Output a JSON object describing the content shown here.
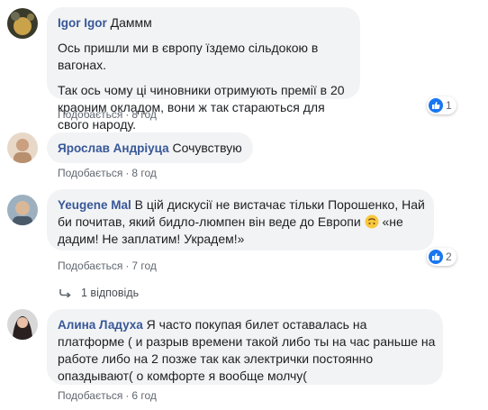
{
  "comments": [
    {
      "author": "Igor Igor",
      "text_inline": "Даммм",
      "paragraphs": [
        "Ось пришли ми в європу їздемо сільдокою в вагонах.",
        "Так ось чому ці чиновники отримують премії в 20 краоним окладом, вони ж так стараються для свого народу."
      ],
      "like": "Подобається",
      "time": "8 год",
      "reactions": "1"
    },
    {
      "author": "Ярослав Андріуца",
      "text_inline": "Сочувствую",
      "like": "Подобається",
      "time": "8 год"
    },
    {
      "author": "Yeugene Mal",
      "text_line1": "В цій дискусії не вистачає тільки Порошенко, Най",
      "text_line2": "би почитав, який бидло-люмпен він веде до Европи",
      "text_line2b": "«не",
      "text_line3": "дадим! Не заплатим! Украдем!»",
      "like": "Подобається",
      "time": "7 год",
      "reactions": "2",
      "replies": "1 відповідь"
    },
    {
      "author": "Алина Ладуха",
      "text_line1": "Я часто покупая билет оставалась на",
      "text_line2": "платформе ( и разрыв времени такой либо ты на час раньше на",
      "text_line3": "работе либо на 2 позже так как электрички постоянно",
      "text_line4": "опаздывают( о комфорте я вообще молчу(",
      "like": "Подобається",
      "time": "6 год"
    }
  ],
  "colors": {
    "author": "#385898",
    "bubble": "#f2f3f5",
    "meta": "#606770",
    "like_badge": "#1877f2"
  },
  "icons": [
    "thumbs-up-icon",
    "upside-down-face-emoji",
    "reply-arrow-icon"
  ]
}
